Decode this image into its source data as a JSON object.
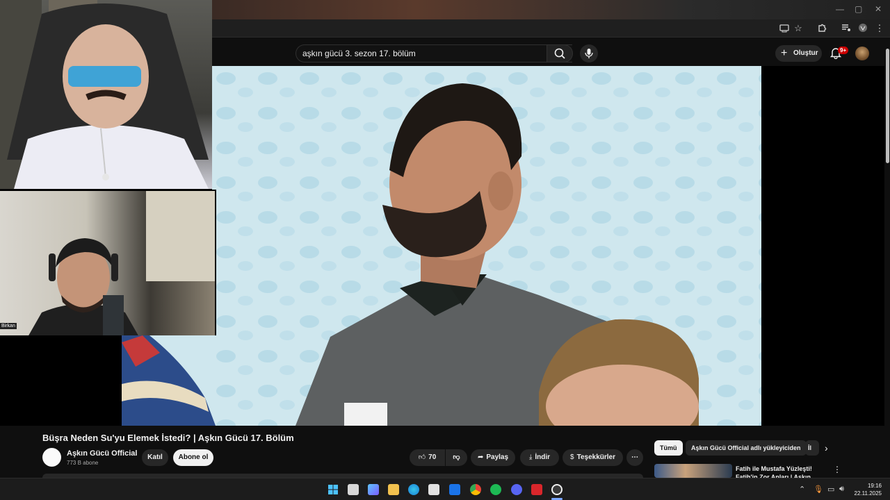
{
  "window": {
    "minimize": "—",
    "maximize": "▢",
    "close": "✕"
  },
  "browser_toolbar": {
    "icons": [
      "cast-icon",
      "star-icon",
      "extensions-icon",
      "media-icon",
      "profile-icon",
      "menu-icon"
    ]
  },
  "header": {
    "search_query": "aşkın gücü 3. sezon 17. bölüm",
    "create_label": "Oluştur",
    "notification_badge": "9+"
  },
  "webcam": {
    "streamer_name": "Birkan"
  },
  "video": {
    "title": "Büşra Neden Su'yu Elemek İstedi? | Aşkın Gücü 17. Bölüm",
    "channel": "Aşkın Gücü Official",
    "subscribers": "773 B abone",
    "join_label": "Katıl",
    "subscribe_label": "Abone ol",
    "like_count": "70",
    "share_label": "Paylaş",
    "download_label": "İndir",
    "thanks_label": "Teşekkürler",
    "more_label": "⋯"
  },
  "sidebar": {
    "chips": [
      "Tümü",
      "Aşkın Gücü Official adlı yükleyiciden",
      "İl"
    ],
    "rec_title": "Fatih ile Mustafa Yüzleşti! Fatih'in Zor Anları | Aşkın Gücü"
  },
  "taskbar": {
    "time": "19:16",
    "date": "22.11.2025",
    "accent": "#0078d4"
  }
}
